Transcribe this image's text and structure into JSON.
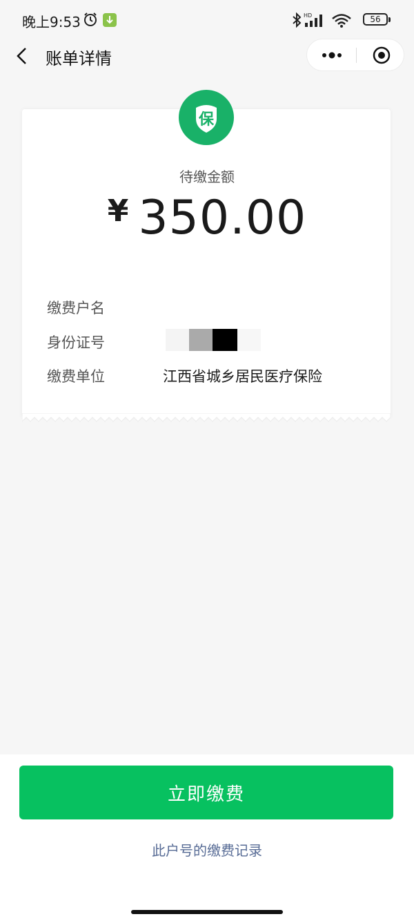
{
  "status_bar": {
    "time": "晚上9:53",
    "network": "HD",
    "battery": "56"
  },
  "nav": {
    "title": "账单详情"
  },
  "bill": {
    "badge_text": "保",
    "amount_label": "待缴金额",
    "currency": "¥",
    "amount": "350.00",
    "fields": [
      {
        "label": "缴费户名",
        "value": ""
      },
      {
        "label": "身份证号",
        "value": ""
      },
      {
        "label": "缴费单位",
        "value": "江西省城乡居民医疗保险"
      }
    ]
  },
  "actions": {
    "pay_button": "立即缴费",
    "records_link": "此户号的缴费记录"
  },
  "colors": {
    "primary_green": "#07c160",
    "badge_green": "#19b168",
    "link_blue": "#576b95",
    "background": "#f6f6f6"
  }
}
